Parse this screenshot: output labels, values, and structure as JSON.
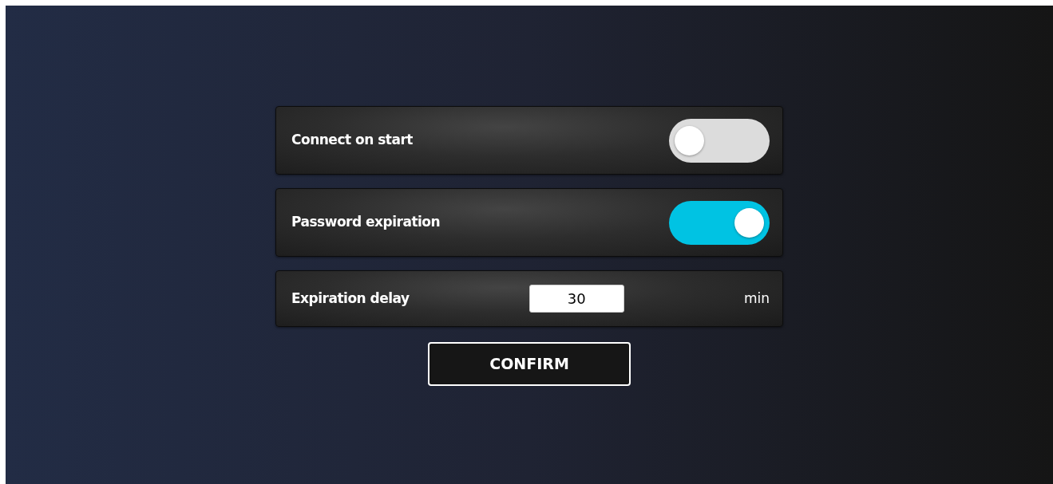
{
  "settings": [
    {
      "kind": "toggle",
      "label": "Connect on start",
      "on": false
    },
    {
      "kind": "toggle",
      "label": "Password expiration",
      "on": true
    },
    {
      "kind": "number",
      "label": "Expiration delay",
      "value": "30",
      "unit": "min"
    }
  ],
  "confirm_button": {
    "label": "CONFIRM"
  }
}
